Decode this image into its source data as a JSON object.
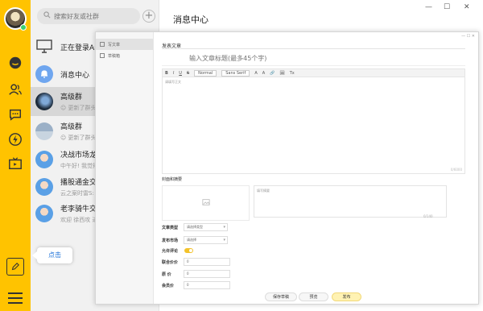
{
  "sidebar": {
    "icons": [
      "chat-bubble-icon",
      "contacts-icon",
      "group-chat-icon",
      "lightning-icon",
      "tv-icon"
    ],
    "edit_icon": "edit-icon",
    "menu_icon": "menu-icon",
    "accent": "#ffc300"
  },
  "sessions": {
    "search_placeholder": "搜索好友或社群",
    "add_label": "+",
    "items": [
      {
        "title": "正在登录Andr",
        "sub": ""
      },
      {
        "title": "消息中心",
        "sub": ""
      },
      {
        "title": "高级群",
        "sub": "☺ 更新了群头像"
      },
      {
        "title": "高级群",
        "sub": "☺ 更新了群头像"
      },
      {
        "title": "决战市场龙头",
        "sub": "中午好! 我觉得"
      },
      {
        "title": "播股通金交流",
        "sub": "云之案时雷S: 我"
      },
      {
        "title": "老李骑牛交流",
        "sub": "欢迎 徐西攻 进入"
      }
    ]
  },
  "main": {
    "title": "消息中心",
    "win_min": "—",
    "win_max": "☐",
    "win_close": "✕"
  },
  "dialog": {
    "side_items": [
      "写文章",
      "草稿箱"
    ],
    "win_buttons": "— ☐ ✕",
    "heading": "发表文章",
    "title_placeholder": "输入文章标题(最多45个字)",
    "toolbar": {
      "b": "B",
      "i": "I",
      "u": "U",
      "s": "S",
      "format": "Normal",
      "font": "Sans Serif",
      "a1": "A",
      "a2": "A",
      "link": "🔗",
      "img": "🖼",
      "clear": "Tx"
    },
    "editor_placeholder": "请填写正文",
    "editor_count": "0/6000",
    "cover_label": "封面和摘要",
    "summary_placeholder": "填写摘要",
    "summary_count": "0/140",
    "fields": {
      "type_label": "文章类型",
      "type_value": "请选择类型",
      "market_label": "发布市场",
      "market_value": "请选择",
      "comment_label": "允许评论",
      "price_label": "联合价价",
      "price_value": "0",
      "discount_label": "原 价",
      "discount_value": "0",
      "member_label": "会员价",
      "member_value": "0"
    },
    "buttons": {
      "save": "保存草稿",
      "preview": "预览",
      "publish": "发布"
    }
  },
  "tooltip": {
    "label": "点击"
  }
}
